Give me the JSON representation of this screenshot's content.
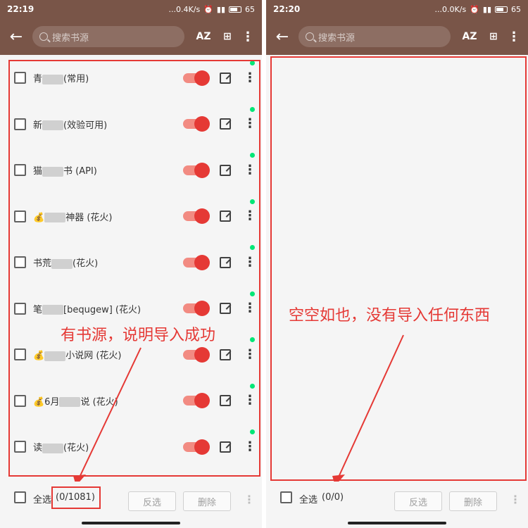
{
  "left": {
    "status": {
      "time": "22:19",
      "speed": "...0.4K/s",
      "battery": "65"
    },
    "search_placeholder": "搜索书源",
    "toolbar": {
      "sort_icon": "AZ",
      "group_icon": "group-icon"
    },
    "items": [
      {
        "prefix": "青",
        "suffix": "(常用)"
      },
      {
        "prefix": "新",
        "suffix": "(效验可用)"
      },
      {
        "prefix": "猫",
        "suffix": "书 (API)"
      },
      {
        "prefix": "💰",
        "suffix": "神器 (花火)"
      },
      {
        "prefix": "书荒",
        "suffix": "(花火)"
      },
      {
        "prefix": "笔",
        "suffix": "[bequgew] (花火)"
      },
      {
        "prefix": "💰",
        "suffix": "小说网 (花火)"
      },
      {
        "prefix": "💰6月",
        "suffix": "说 (花火)"
      },
      {
        "prefix": "读",
        "suffix": "(花火)"
      }
    ],
    "annotation": "有书源，说明导入成功",
    "bottom": {
      "select_all": "全选",
      "count": "(0/1081)",
      "invert": "反选",
      "delete": "删除"
    }
  },
  "right": {
    "status": {
      "time": "22:20",
      "speed": "...0.0K/s",
      "battery": "65"
    },
    "search_placeholder": "搜索书源",
    "toolbar": {
      "sort_icon": "AZ",
      "group_icon": "group-icon"
    },
    "annotation": "空空如也，没有导入任何东西",
    "bottom": {
      "select_all": "全选",
      "count": "(0/0)",
      "invert": "反选",
      "delete": "删除"
    }
  },
  "colors": {
    "toolbar": "#795548",
    "accent": "#e53935",
    "enabled_dot": "#00e676"
  }
}
